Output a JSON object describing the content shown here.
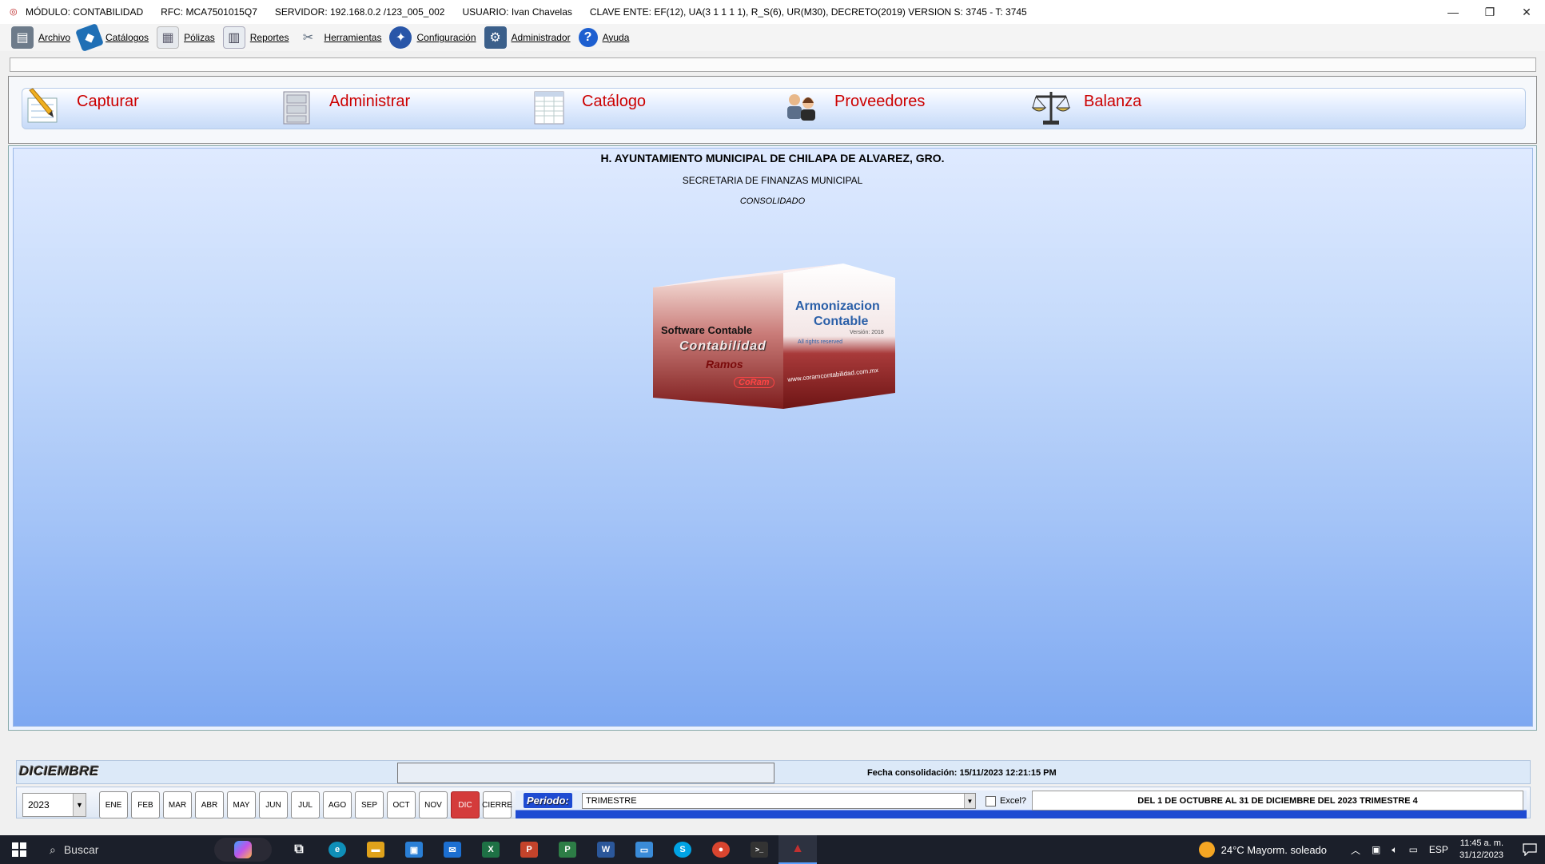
{
  "titlebar": {
    "modulo": "MÓDULO: CONTABILIDAD",
    "rfc": "RFC:  MCA7501015Q7",
    "servidor": "SERVIDOR:  192.168.0.2 /123_005_002",
    "usuario": "USUARIO:  Ivan Chavelas",
    "clave": "CLAVE ENTE:  EF(12),  UA(3 1 1 1 1),  R_S(6),  UR(M30),  DECRETO(2019)  VERSION S: 3745 - T: 3745",
    "minimize": "—",
    "restore": "❐",
    "close": "✕"
  },
  "menu": [
    {
      "label": "Archivo",
      "icon": "archive-icon",
      "color": "#6d7b8a"
    },
    {
      "label": "Catálogos",
      "icon": "books-icon",
      "color": "#1f6fb5"
    },
    {
      "label": "Pólizas",
      "icon": "policies-icon",
      "color": "#9aa3ad"
    },
    {
      "label": "Reportes",
      "icon": "reports-icon",
      "color": "#5a6b80"
    },
    {
      "label": "Herramientas",
      "icon": "tools-icon",
      "color": "#6f7f91"
    },
    {
      "label": "Configuración",
      "icon": "config-icon",
      "color": "#2956a8"
    },
    {
      "label": "Administrador",
      "icon": "admin-icon",
      "color": "#3b5f8a"
    },
    {
      "label": "Ayuda",
      "icon": "help-icon",
      "color": "#1d5fd0"
    }
  ],
  "big_buttons": [
    {
      "label": "Capturar",
      "icon": "capture-pencil-icon"
    },
    {
      "label": "Administrar",
      "icon": "administer-cabinet-icon"
    },
    {
      "label": "Catálogo",
      "icon": "catalog-sheet-icon"
    },
    {
      "label": "Proveedores",
      "icon": "providers-people-icon"
    },
    {
      "label": "Balanza",
      "icon": "scale-icon"
    }
  ],
  "org": {
    "title": "H. AYUNTAMIENTO MUNICIPAL DE CHILAPA DE ALVAREZ, GRO.",
    "subtitle": "SECRETARIA DE FINANZAS MUNICIPAL",
    "mode": "CONSOLIDADO"
  },
  "logo": {
    "line1": "Software Contable",
    "line2": "Contabilidad",
    "line3": "Ramos",
    "badge": "CoRam",
    "right1": "Armonizacion",
    "right2": "Contable",
    "version": "Versión: 2018",
    "rights": "All rights reserved",
    "url": "www.coramcontabilidad.com.mx"
  },
  "status": {
    "month": "DICIEMBRE",
    "fecha": "Fecha consolidación: 15/11/2023 12:21:15 PM",
    "year": "2023",
    "months": [
      "ENE",
      "FEB",
      "MAR",
      "ABR",
      "MAY",
      "JUN",
      "JUL",
      "AGO",
      "SEP",
      "OCT",
      "NOV",
      "DIC",
      "CIERRE"
    ],
    "active_month": "DIC",
    "periodo_label": "Periodo:",
    "periodo_value": "TRIMESTRE",
    "excel_label": "Excel?",
    "range": "DEL 1 DE OCTUBRE AL 31 DE DICIEMBRE DEL 2023 TRIMESTRE 4"
  },
  "taskbar": {
    "search": "Buscar",
    "weather": "24°C  Mayorm. soleado",
    "lang": "ESP",
    "time": "11:45 a. m.",
    "date": "31/12/2023",
    "apps": [
      {
        "name": "task-view-icon",
        "glyph": "⧉",
        "color": "#1b1f2a"
      },
      {
        "name": "edge-icon",
        "glyph": "e",
        "color": "#0f8fb8"
      },
      {
        "name": "file-explorer-icon",
        "glyph": "▬",
        "color": "#e0a21b"
      },
      {
        "name": "store-icon",
        "glyph": "▣",
        "color": "#2a7fd6"
      },
      {
        "name": "mail-icon",
        "glyph": "✉",
        "color": "#1c6fd1"
      },
      {
        "name": "excel-icon",
        "glyph": "X",
        "color": "#1e7145"
      },
      {
        "name": "powerpoint-icon",
        "glyph": "P",
        "color": "#c4432b"
      },
      {
        "name": "project-icon",
        "glyph": "P",
        "color": "#2d7d46"
      },
      {
        "name": "word-icon",
        "glyph": "W",
        "color": "#2b579a"
      },
      {
        "name": "remote-desktop-icon",
        "glyph": "▭",
        "color": "#3a8bd8"
      },
      {
        "name": "skype-icon",
        "glyph": "S",
        "color": "#00a3e4"
      },
      {
        "name": "chrome-icon",
        "glyph": "●",
        "color": "#d9452f"
      },
      {
        "name": "terminal-icon",
        "glyph": ">_",
        "color": "#333"
      },
      {
        "name": "contabilidad-app-icon",
        "glyph": "▲",
        "color": "#a32525"
      }
    ]
  }
}
